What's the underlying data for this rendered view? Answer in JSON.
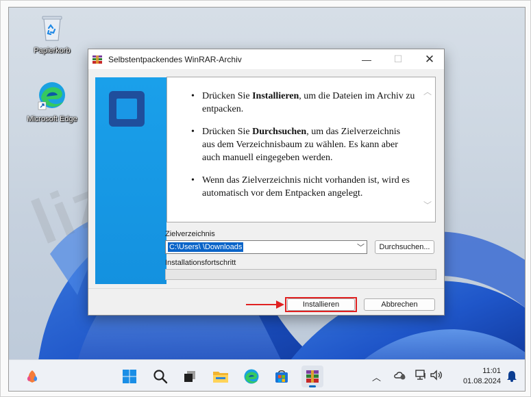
{
  "desktop": {
    "icons": [
      {
        "label": "Papierkorb",
        "icon": "recycle-bin-icon"
      },
      {
        "label": "Microsoft Edge",
        "icon": "edge-icon"
      }
    ],
    "watermark": "lizenzstar.de"
  },
  "dialog": {
    "title": "Selbstentpackendes WinRAR-Archiv",
    "controls": {
      "minimize": "—",
      "maximize": "☐",
      "close": "✕"
    },
    "info": [
      {
        "pre": "Drücken Sie ",
        "bold": "Installieren",
        "post": ", um die Dateien im Archiv zu entpacken."
      },
      {
        "pre": "Drücken Sie ",
        "bold": "Durchsuchen",
        "post": ", um das Zielverzeichnis aus dem Verzeichnisbaum zu wählen. Es kann aber auch manuell eingegeben werden."
      },
      {
        "pre": "",
        "bold": "",
        "post": "Wenn das Zielverzeichnis nicht vorhanden ist, wird es automatisch vor dem Entpacken angelegt."
      }
    ],
    "destination": {
      "label": "Zielverzeichnis",
      "value": "C:\\Users\\        \\Downloads",
      "browse_label": "Durchsuchen..."
    },
    "progress": {
      "label": "Installationsfortschritt",
      "fraction": 0
    },
    "install_label": "Installieren",
    "cancel_label": "Abbrechen",
    "accent_color": "#e02020"
  },
  "taskbar": {
    "items": [
      "copilot-icon",
      "start-icon",
      "search-icon",
      "task-view-icon",
      "file-explorer-icon",
      "edge-icon",
      "store-icon",
      "winrar-icon"
    ],
    "active_item": "winrar-icon",
    "tray": [
      "chevron-up-icon",
      "onedrive-icon",
      "network-icon",
      "volume-icon",
      "notification-bell-icon"
    ],
    "time": "11:01",
    "date": "01.08.2024"
  }
}
